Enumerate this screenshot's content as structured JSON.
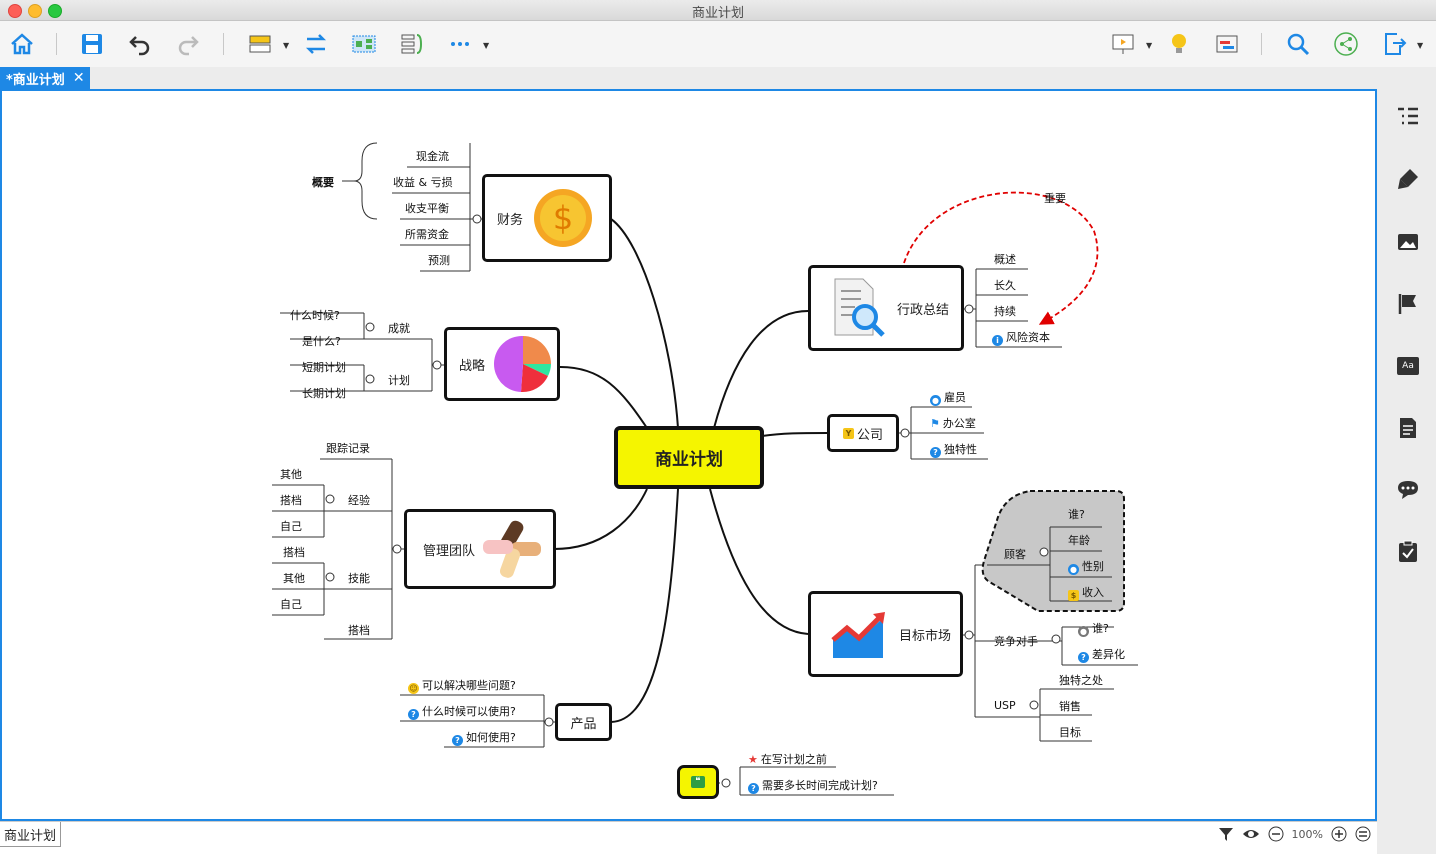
{
  "window": {
    "title": "商业计划"
  },
  "tab": {
    "label": "*商业计划",
    "close": "✕"
  },
  "sheet": {
    "label": "商业计划"
  },
  "status": {
    "zoom": "100%"
  },
  "map": {
    "center": "商业计划",
    "finance": {
      "label": "财务",
      "summary": "概要",
      "items": [
        "现金流",
        "收益 & 亏损",
        "收支平衡",
        "所需资金",
        "预测"
      ]
    },
    "strategy": {
      "label": "战略",
      "achieve": "成就",
      "plan": "计划",
      "a1": "什么时候?",
      "a2": "是什么?",
      "p1": "短期计划",
      "p2": "长期计划"
    },
    "team": {
      "label": "管理团队",
      "track": "跟踪记录",
      "exp": "经验",
      "skill": "技能",
      "exp_items": [
        "其他",
        "搭档",
        "自己"
      ],
      "skill_items": [
        "搭档",
        "其他",
        "自己"
      ],
      "last": "搭档"
    },
    "product": {
      "label": "产品",
      "items": [
        "可以解决哪些问题?",
        "什么时候可以使用?",
        "如何使用?"
      ]
    },
    "admin": {
      "label": "行政总结",
      "items": [
        "概述",
        "长久",
        "持续",
        "风险资本"
      ],
      "relation": "重要"
    },
    "company": {
      "label": "公司",
      "items": [
        "雇员",
        "办公室",
        "独特性"
      ]
    },
    "market": {
      "label": "目标市场",
      "customer": "顾客",
      "customer_items": [
        "谁?",
        "年龄",
        "性别",
        "收入"
      ],
      "competitor": "竞争对手",
      "competitor_items": [
        "谁?",
        "差异化"
      ],
      "usp": "USP",
      "usp_items": [
        "独特之处",
        "销售",
        "目标"
      ]
    },
    "floating": {
      "items": [
        "在写计划之前",
        "需要多长时间完成计划?"
      ]
    }
  },
  "colors": {
    "accent": "#1e88e5",
    "center_fill": "#f5f500",
    "relation": "#e00000"
  }
}
